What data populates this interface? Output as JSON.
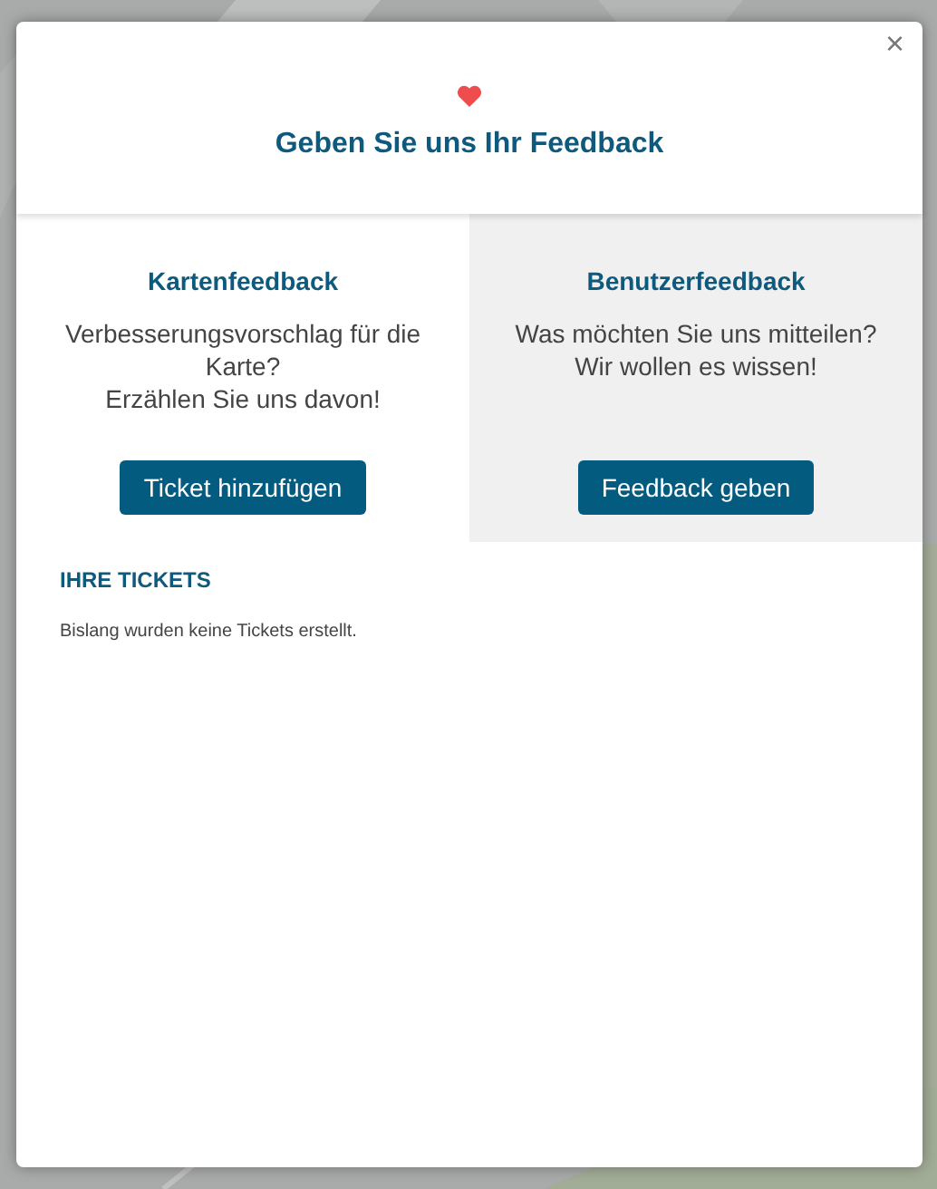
{
  "dialog": {
    "title": "Geben Sie uns Ihr Feedback",
    "close": "×"
  },
  "options": [
    {
      "title": "Kartenfeedback",
      "text": "Verbesserungsvorschlag für die Karte?\nErzählen Sie uns davon!",
      "button": "Ticket hinzufügen",
      "selected": true
    },
    {
      "title": "Benutzerfeedback",
      "text": "Was möchten Sie uns mitteilen? Wir wollen es wissen!",
      "button": "Feedback geben",
      "selected": false
    }
  ],
  "tickets": {
    "heading": "IHRE TICKETS",
    "empty": "Bislang wurden keine Tickets erstellt."
  }
}
